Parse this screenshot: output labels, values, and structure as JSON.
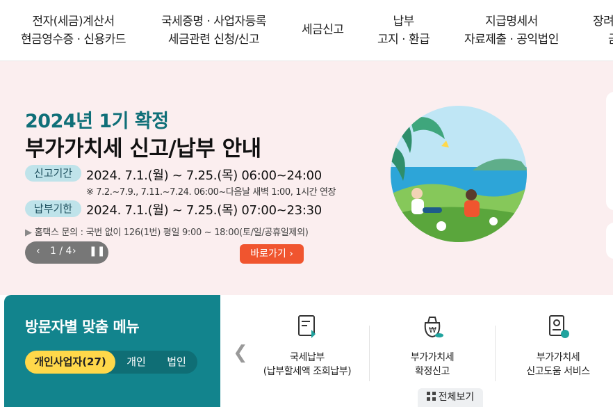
{
  "nav": {
    "items": [
      {
        "line1": "전자(세금)계산서",
        "line2": "현금영수증 · 신용카드"
      },
      {
        "line1": "국세증명 · 사업자등록",
        "line2": "세금관련 신청/신고"
      },
      {
        "line1": "세금신고",
        "line2": ""
      },
      {
        "line1": "납부",
        "line2": "고지 · 환급"
      },
      {
        "line1": "지급명세서",
        "line2": "자료제출 · 공익법인"
      },
      {
        "line1": "장려",
        "line2": "금"
      }
    ]
  },
  "banner": {
    "subtitle": "2024년 1기 확정",
    "title": "부가가치세 신고/납부 안내",
    "report_label": "신고기간",
    "report_period": "2024. 7.1.(월) ~ 7.25.(목) 06:00~24:00",
    "note": "※ 7.2.~7.9., 7.11.~7.24. 06:00~다음날 새벽 1:00, 1시간 연장",
    "pay_label": "납부기한",
    "pay_period": "2024. 7.1.(월) ~ 7.25.(목) 07:00~23:30",
    "inquiry": "홈택스 문의 : 국번 없이 126(1번) 평일 9:00 ~ 18:00(토/일/공휴일제외)",
    "pager": "1 / 4",
    "go_label": "바로가기",
    "colors": {
      "background": "#fbeeef",
      "accent": "#0f6f78",
      "button": "#f0552f"
    }
  },
  "visitor": {
    "title": "방문자별 맞춤 메뉴",
    "tabs": [
      "개인사업자(27)",
      "개인",
      "법인"
    ],
    "active_tab": 0,
    "colors": {
      "panel": "#12848d",
      "active_tab": "#ffd84a"
    }
  },
  "quick_menu": {
    "items": [
      {
        "line1": "국세납부",
        "line2": "(납부할세액 조회납부)",
        "icon": "tax-payment-icon"
      },
      {
        "line1": "부가가치세",
        "line2": "확정신고",
        "icon": "vat-report-icon"
      },
      {
        "line1": "부가가치세",
        "line2": "신고도움 서비스",
        "icon": "vat-help-icon"
      }
    ],
    "view_all": "전체보기"
  }
}
